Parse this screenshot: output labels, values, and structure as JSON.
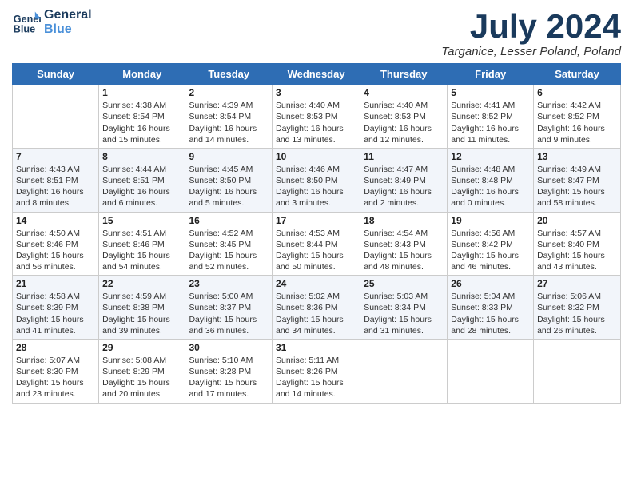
{
  "header": {
    "logo_line1": "General",
    "logo_line2": "Blue",
    "month": "July 2024",
    "location": "Targanice, Lesser Poland, Poland"
  },
  "weekdays": [
    "Sunday",
    "Monday",
    "Tuesday",
    "Wednesday",
    "Thursday",
    "Friday",
    "Saturday"
  ],
  "weeks": [
    [
      {
        "day": "",
        "info": ""
      },
      {
        "day": "1",
        "info": "Sunrise: 4:38 AM\nSunset: 8:54 PM\nDaylight: 16 hours\nand 15 minutes."
      },
      {
        "day": "2",
        "info": "Sunrise: 4:39 AM\nSunset: 8:54 PM\nDaylight: 16 hours\nand 14 minutes."
      },
      {
        "day": "3",
        "info": "Sunrise: 4:40 AM\nSunset: 8:53 PM\nDaylight: 16 hours\nand 13 minutes."
      },
      {
        "day": "4",
        "info": "Sunrise: 4:40 AM\nSunset: 8:53 PM\nDaylight: 16 hours\nand 12 minutes."
      },
      {
        "day": "5",
        "info": "Sunrise: 4:41 AM\nSunset: 8:52 PM\nDaylight: 16 hours\nand 11 minutes."
      },
      {
        "day": "6",
        "info": "Sunrise: 4:42 AM\nSunset: 8:52 PM\nDaylight: 16 hours\nand 9 minutes."
      }
    ],
    [
      {
        "day": "7",
        "info": "Sunrise: 4:43 AM\nSunset: 8:51 PM\nDaylight: 16 hours\nand 8 minutes."
      },
      {
        "day": "8",
        "info": "Sunrise: 4:44 AM\nSunset: 8:51 PM\nDaylight: 16 hours\nand 6 minutes."
      },
      {
        "day": "9",
        "info": "Sunrise: 4:45 AM\nSunset: 8:50 PM\nDaylight: 16 hours\nand 5 minutes."
      },
      {
        "day": "10",
        "info": "Sunrise: 4:46 AM\nSunset: 8:50 PM\nDaylight: 16 hours\nand 3 minutes."
      },
      {
        "day": "11",
        "info": "Sunrise: 4:47 AM\nSunset: 8:49 PM\nDaylight: 16 hours\nand 2 minutes."
      },
      {
        "day": "12",
        "info": "Sunrise: 4:48 AM\nSunset: 8:48 PM\nDaylight: 16 hours\nand 0 minutes."
      },
      {
        "day": "13",
        "info": "Sunrise: 4:49 AM\nSunset: 8:47 PM\nDaylight: 15 hours\nand 58 minutes."
      }
    ],
    [
      {
        "day": "14",
        "info": "Sunrise: 4:50 AM\nSunset: 8:46 PM\nDaylight: 15 hours\nand 56 minutes."
      },
      {
        "day": "15",
        "info": "Sunrise: 4:51 AM\nSunset: 8:46 PM\nDaylight: 15 hours\nand 54 minutes."
      },
      {
        "day": "16",
        "info": "Sunrise: 4:52 AM\nSunset: 8:45 PM\nDaylight: 15 hours\nand 52 minutes."
      },
      {
        "day": "17",
        "info": "Sunrise: 4:53 AM\nSunset: 8:44 PM\nDaylight: 15 hours\nand 50 minutes."
      },
      {
        "day": "18",
        "info": "Sunrise: 4:54 AM\nSunset: 8:43 PM\nDaylight: 15 hours\nand 48 minutes."
      },
      {
        "day": "19",
        "info": "Sunrise: 4:56 AM\nSunset: 8:42 PM\nDaylight: 15 hours\nand 46 minutes."
      },
      {
        "day": "20",
        "info": "Sunrise: 4:57 AM\nSunset: 8:40 PM\nDaylight: 15 hours\nand 43 minutes."
      }
    ],
    [
      {
        "day": "21",
        "info": "Sunrise: 4:58 AM\nSunset: 8:39 PM\nDaylight: 15 hours\nand 41 minutes."
      },
      {
        "day": "22",
        "info": "Sunrise: 4:59 AM\nSunset: 8:38 PM\nDaylight: 15 hours\nand 39 minutes."
      },
      {
        "day": "23",
        "info": "Sunrise: 5:00 AM\nSunset: 8:37 PM\nDaylight: 15 hours\nand 36 minutes."
      },
      {
        "day": "24",
        "info": "Sunrise: 5:02 AM\nSunset: 8:36 PM\nDaylight: 15 hours\nand 34 minutes."
      },
      {
        "day": "25",
        "info": "Sunrise: 5:03 AM\nSunset: 8:34 PM\nDaylight: 15 hours\nand 31 minutes."
      },
      {
        "day": "26",
        "info": "Sunrise: 5:04 AM\nSunset: 8:33 PM\nDaylight: 15 hours\nand 28 minutes."
      },
      {
        "day": "27",
        "info": "Sunrise: 5:06 AM\nSunset: 8:32 PM\nDaylight: 15 hours\nand 26 minutes."
      }
    ],
    [
      {
        "day": "28",
        "info": "Sunrise: 5:07 AM\nSunset: 8:30 PM\nDaylight: 15 hours\nand 23 minutes."
      },
      {
        "day": "29",
        "info": "Sunrise: 5:08 AM\nSunset: 8:29 PM\nDaylight: 15 hours\nand 20 minutes."
      },
      {
        "day": "30",
        "info": "Sunrise: 5:10 AM\nSunset: 8:28 PM\nDaylight: 15 hours\nand 17 minutes."
      },
      {
        "day": "31",
        "info": "Sunrise: 5:11 AM\nSunset: 8:26 PM\nDaylight: 15 hours\nand 14 minutes."
      },
      {
        "day": "",
        "info": ""
      },
      {
        "day": "",
        "info": ""
      },
      {
        "day": "",
        "info": ""
      }
    ]
  ]
}
